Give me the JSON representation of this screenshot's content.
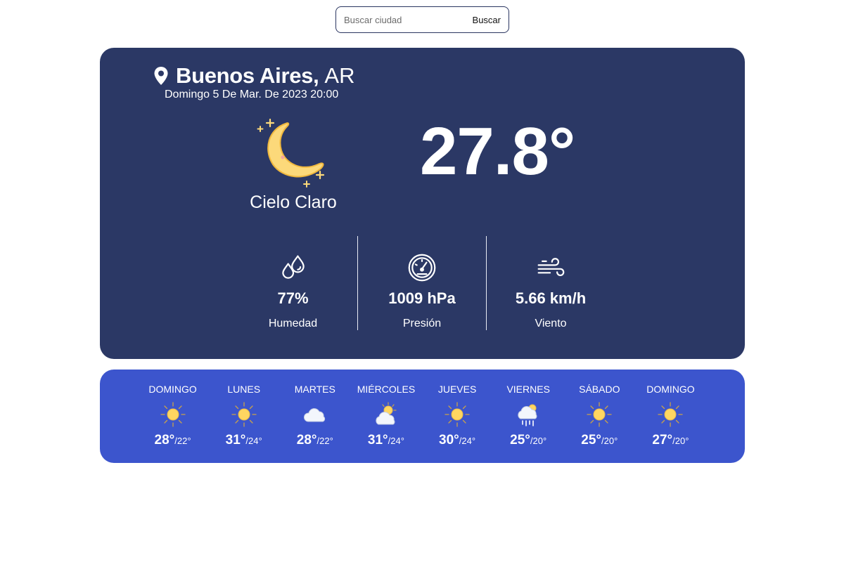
{
  "search": {
    "placeholder": "Buscar ciudad",
    "button_label": "Buscar"
  },
  "current": {
    "city": "Buenos Aires,",
    "country": "AR",
    "date": "Domingo 5 De Mar. De 2023 20:00",
    "condition_icon": "crescent-moon-icon",
    "condition": "Cielo Claro",
    "temperature": "27.8°",
    "stats": [
      {
        "icon": "humidity-drops-icon",
        "value": "77%",
        "label": "Humedad"
      },
      {
        "icon": "pressure-gauge-icon",
        "value": "1009 hPa",
        "label": "Presión"
      },
      {
        "icon": "wind-icon",
        "value": "5.66 km/h",
        "label": "Viento"
      }
    ]
  },
  "forecast": [
    {
      "day": "DOMINGO",
      "icon": "sun-icon",
      "max": "28°",
      "min": "/22°"
    },
    {
      "day": "LUNES",
      "icon": "sun-icon",
      "max": "31°",
      "min": "/24°"
    },
    {
      "day": "MARTES",
      "icon": "cloud-icon",
      "max": "28°",
      "min": "/22°"
    },
    {
      "day": "MIÉRCOLES",
      "icon": "partly-cloudy-icon",
      "max": "31°",
      "min": "/24°"
    },
    {
      "day": "JUEVES",
      "icon": "sun-icon",
      "max": "30°",
      "min": "/24°"
    },
    {
      "day": "VIERNES",
      "icon": "rain-cloud-icon",
      "max": "25°",
      "min": "/20°"
    },
    {
      "day": "SÁBADO",
      "icon": "sun-icon",
      "max": "25°",
      "min": "/20°"
    },
    {
      "day": "DOMINGO",
      "icon": "sun-icon",
      "max": "27°",
      "min": "/20°"
    }
  ],
  "colors": {
    "main_card_bg": "#2b3865",
    "forecast_bg": "#3c55cd",
    "moon": "#fcd97a",
    "sun": "#ffd661"
  }
}
